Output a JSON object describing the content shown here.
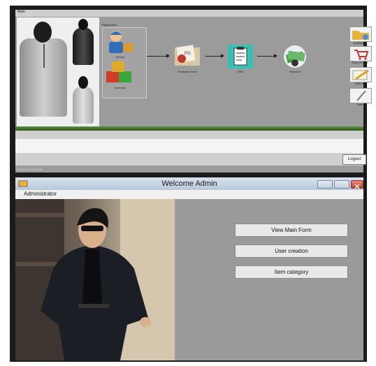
{
  "top_window": {
    "title": "Main",
    "registration_label": "Registration",
    "workflow_nodes": [
      {
        "label": "Vendor"
      },
      {
        "label": "Inventory"
      },
      {
        "label": "Purchase Order"
      },
      {
        "label": "GRN"
      },
      {
        "label": "Payment"
      }
    ],
    "side_buttons": [
      {
        "label": "Availability"
      },
      {
        "label": "Point of Sale"
      },
      {
        "label": "Returns"
      },
      {
        "label": "Note"
      }
    ],
    "logout_label": "Logout",
    "timestamp": "7/8/2017 9:39:40 AM"
  },
  "admin_window": {
    "title": "Welcome Admin",
    "menu_item": "Administrator",
    "buttons": {
      "view_main_form": "View Main Form",
      "user_creation": "User creation",
      "item_category": "Item category"
    }
  },
  "colors": {
    "window_bg": "#9a9a9a",
    "green_bar": "#4a7a30",
    "title_gradient_top": "#d9e3ee",
    "close_button": "#c24130"
  }
}
